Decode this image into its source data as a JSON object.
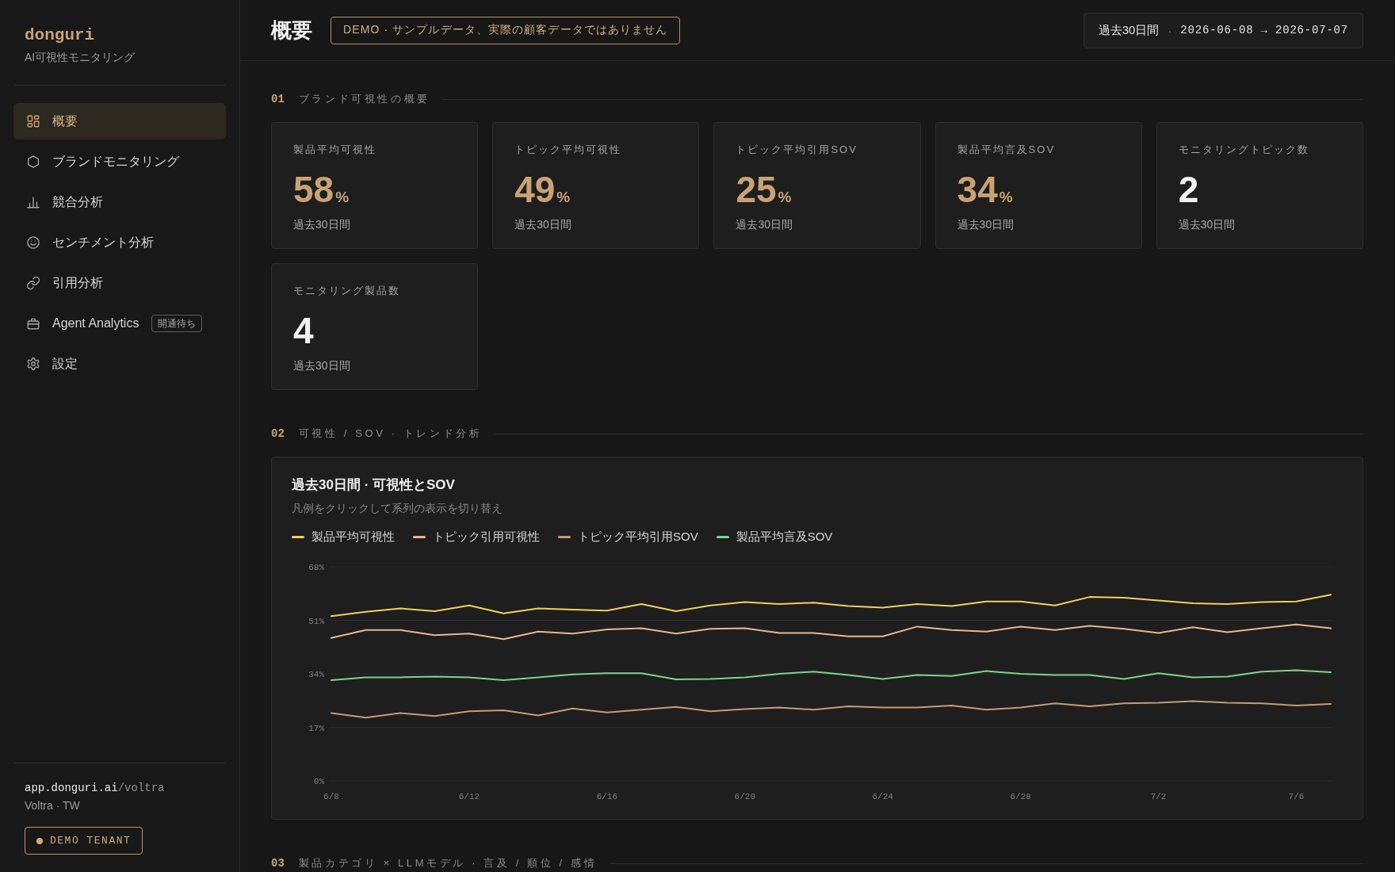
{
  "sidebar": {
    "logo": "donguri",
    "tagline": "AI可視性モニタリング",
    "nav": [
      {
        "label": "概要",
        "selected": true
      },
      {
        "label": "ブランドモニタリング",
        "selected": false
      },
      {
        "label": "競合分析",
        "selected": false
      },
      {
        "label": "センチメント分析",
        "selected": false
      },
      {
        "label": "引用分析",
        "selected": false
      },
      {
        "label": "Agent Analytics",
        "badge": "開通待ち",
        "selected": false
      },
      {
        "label": "設定",
        "selected": false
      }
    ],
    "footer": {
      "url_host": "app.donguri.ai",
      "url_path": "/voltra",
      "tenant": "Voltra · TW",
      "tenant_badge": "DEMO TENANT"
    }
  },
  "header": {
    "title": "概要",
    "demo_notice": "DEMO · サンプルデータ、実際の顧客データではありません",
    "date_range": {
      "label": "過去30日間",
      "separator": "·",
      "dates": "2026-06-08 → 2026-07-07"
    }
  },
  "sections": [
    {
      "number": "01",
      "title": "ブランド可視性の概要",
      "cards": [
        {
          "kind": "percent",
          "label": "製品平均可視性",
          "value": "58",
          "unit": "%",
          "note": "過去30日間"
        },
        {
          "kind": "percent",
          "label": "トピック平均可視性",
          "value": "49",
          "unit": "%",
          "note": "過去30日間"
        },
        {
          "kind": "percent",
          "label": "トピック平均引用SOV",
          "value": "25",
          "unit": "%",
          "note": "過去30日間"
        },
        {
          "kind": "percent",
          "label": "製品平均言及SOV",
          "value": "34",
          "unit": "%",
          "note": "過去30日間"
        },
        {
          "kind": "count",
          "label": "モニタリングトピック数",
          "value": "2",
          "note": "過去30日間"
        },
        {
          "kind": "count",
          "label": "モニタリング製品数",
          "value": "4",
          "note": "過去30日間"
        }
      ]
    },
    {
      "number": "02",
      "title": "可視性 / SOV · トレンド分析",
      "chart": {
        "subtitle": "凡例をクリックして系列の表示を切り替え",
        "chart_data": {
          "type": "line",
          "title": "過去30日間 · 可視性とSOV",
          "grid": true,
          "categories": [
            "6/8",
            null,
            null,
            null,
            "6/12",
            null,
            null,
            null,
            "6/16",
            null,
            null,
            null,
            "6/20",
            null,
            null,
            null,
            "6/24",
            null,
            null,
            null,
            "6/28",
            null,
            null,
            null,
            "7/2",
            null,
            null,
            null,
            "7/6",
            null
          ],
          "ylim": [
            0,
            68
          ],
          "yticks": [
            {
              "value": 68,
              "label": "68%"
            },
            {
              "value": 51,
              "label": "51%"
            },
            {
              "value": 34,
              "label": "34%"
            },
            {
              "value": 17,
              "label": "17%"
            },
            {
              "value": 0,
              "label": "0%"
            }
          ],
          "series": [
            {
              "name": "製品平均可視性",
              "color": "#f2cf5b",
              "values": [
                52.3,
                53.7,
                54.8,
                53.9,
                55.7,
                53.2,
                54.8,
                54.4,
                54.1,
                56.2,
                53.9,
                55.7,
                56.8,
                56.2,
                56.6,
                55.5,
                55.0,
                56.2,
                55.5,
                57.0,
                57.0,
                55.7,
                58.4,
                58.2,
                57.3,
                56.4,
                56.2,
                56.8,
                57.0,
                59.1
              ]
            },
            {
              "name": "トピック引用可視性",
              "color": "#e6b98a",
              "values": [
                45.4,
                47.9,
                47.9,
                46.3,
                46.8,
                45.0,
                47.4,
                46.8,
                48.1,
                48.5,
                46.8,
                48.3,
                48.5,
                47.0,
                47.0,
                45.9,
                45.9,
                49.0,
                47.9,
                47.4,
                49.0,
                47.9,
                49.2,
                48.3,
                47.0,
                48.8,
                47.2,
                48.5,
                49.7,
                48.5
              ]
            },
            {
              "name": "トピック平均引用SOV",
              "color": "#c49d76",
              "values": [
                21.5,
                20.1,
                21.5,
                20.6,
                22.1,
                22.4,
                20.8,
                23.0,
                21.7,
                22.6,
                23.5,
                22.1,
                22.8,
                23.3,
                22.6,
                23.7,
                23.3,
                23.3,
                23.9,
                22.6,
                23.3,
                24.6,
                23.7,
                24.6,
                24.8,
                25.3,
                24.8,
                24.6,
                23.9,
                24.4
              ]
            },
            {
              "name": "製品平均言及SOV",
              "color": "#7ed38b",
              "values": [
                32.0,
                32.9,
                32.9,
                33.1,
                32.9,
                32.0,
                32.9,
                33.8,
                34.2,
                34.2,
                32.2,
                32.4,
                32.9,
                34.0,
                34.7,
                33.6,
                32.4,
                33.6,
                33.3,
                34.9,
                34.0,
                33.6,
                33.6,
                32.4,
                34.2,
                32.9,
                33.1,
                34.7,
                35.1,
                34.5
              ]
            }
          ]
        }
      }
    },
    {
      "number": "03",
      "title": "製品カテゴリ × LLMモデル · 言及 / 順位 / 感情"
    }
  ]
}
